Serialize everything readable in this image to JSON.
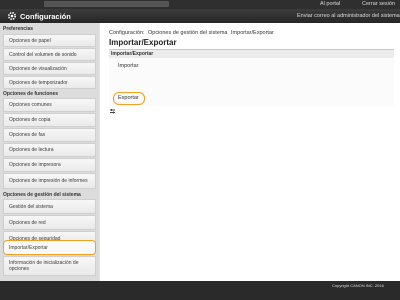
{
  "topbar": {
    "portal": "Al portal",
    "logout": "Cerrar sesión"
  },
  "header": {
    "title": "Configuración",
    "mail_admin": "Enviar correo al administrador del sistema"
  },
  "sidebar": {
    "sections": [
      {
        "title": "Preferencias",
        "items": [
          "Opciones de papel",
          "Control del volumen de sonido",
          "Opciones de visualización",
          "Opciones de temporizador"
        ]
      },
      {
        "title": "Opciones de funciones",
        "items": [
          "Opciones comunes",
          "Opciones de copia",
          "Opciones de fax",
          "Opciones de lectura",
          "Opciones de impresora",
          "Opciones de impresión de informes"
        ]
      },
      {
        "title": "Opciones de gestión del sistema",
        "items": [
          "Gestión del sistema",
          "Opciones de red",
          "Opciones de seguridad",
          "Importar/Exportar",
          "Información de inicialización de opciones"
        ]
      }
    ],
    "active_item": "Importar/Exportar"
  },
  "breadcrumb": [
    "Configuración:",
    "Opciones de gestión del sistema",
    "Importar/Exportar"
  ],
  "page_title": "Importar/Exportar",
  "panel": {
    "heading": "Importar/Exportar",
    "links": {
      "import": "Importar",
      "export": "Exportar"
    }
  },
  "footer": {
    "copyright": "Copyright CANON INC. 2016"
  },
  "colors": {
    "highlight": "#f4a020",
    "header_bg": "#2f2f2f"
  },
  "icons": {
    "header": "gear-icon",
    "tool": "tools-icon"
  }
}
